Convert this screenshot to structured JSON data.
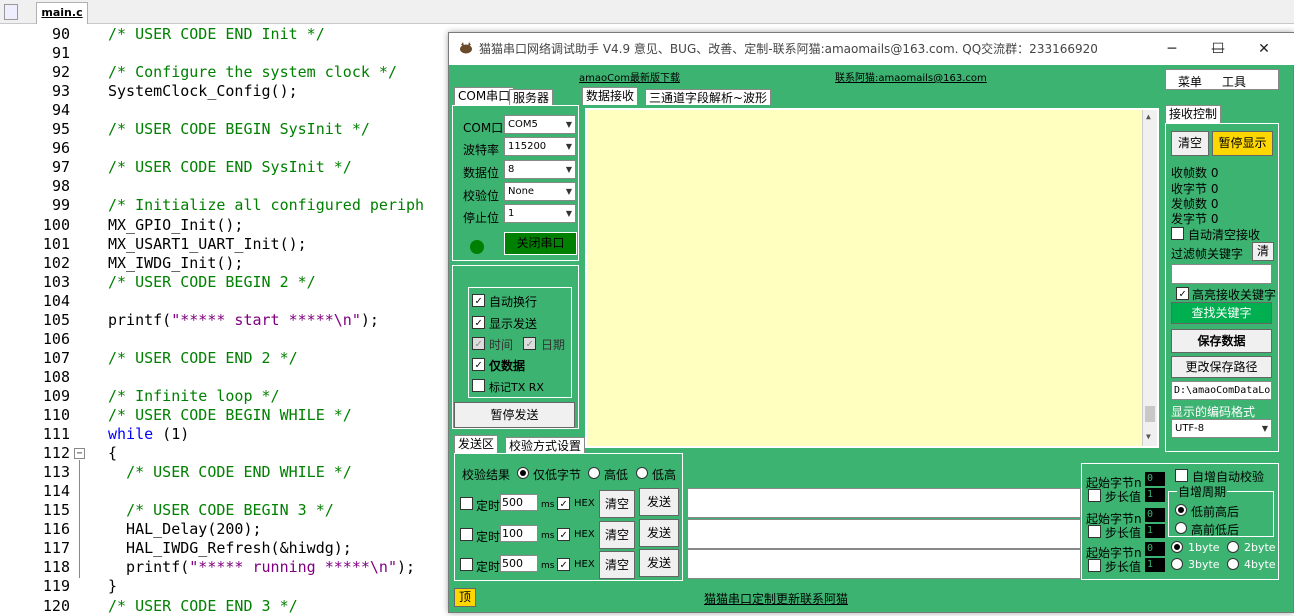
{
  "editor": {
    "tab_label": "main.c",
    "lines": [
      {
        "n": "90",
        "html": "<span class='cm'>/* USER CODE END Init */</span>"
      },
      {
        "n": "91",
        "html": ""
      },
      {
        "n": "92",
        "html": "<span class='cm'>/* Configure the system clock */</span>"
      },
      {
        "n": "93",
        "html": "SystemClock_Config();"
      },
      {
        "n": "94",
        "html": ""
      },
      {
        "n": "95",
        "html": "<span class='cm'>/* USER CODE BEGIN SysInit */</span>"
      },
      {
        "n": "96",
        "html": ""
      },
      {
        "n": "97",
        "html": "<span class='cm'>/* USER CODE END SysInit */</span>"
      },
      {
        "n": "98",
        "html": ""
      },
      {
        "n": "99",
        "html": "<span class='cm'>/* Initialize all configured periph</span>"
      },
      {
        "n": "100",
        "html": "MX_GPIO_Init();"
      },
      {
        "n": "101",
        "html": "MX_USART1_UART_Init();"
      },
      {
        "n": "102",
        "html": "MX_IWDG_Init();"
      },
      {
        "n": "103",
        "html": "<span class='cm'>/* USER CODE BEGIN 2 */</span>"
      },
      {
        "n": "104",
        "html": ""
      },
      {
        "n": "105",
        "html": "printf(<span class='str'>\"***** start *****\\n\"</span>);"
      },
      {
        "n": "106",
        "html": ""
      },
      {
        "n": "107",
        "html": "<span class='cm'>/* USER CODE END 2 */</span>"
      },
      {
        "n": "108",
        "html": ""
      },
      {
        "n": "109",
        "html": "<span class='cm'>/* Infinite loop */</span>"
      },
      {
        "n": "110",
        "html": "<span class='cm'>/* USER CODE BEGIN WHILE */</span>"
      },
      {
        "n": "111",
        "html": "<span class='kw'>while</span> (1)"
      },
      {
        "n": "112",
        "html": "{"
      },
      {
        "n": "113",
        "html": "  <span class='cm'>/* USER CODE END WHILE */</span>"
      },
      {
        "n": "114",
        "html": ""
      },
      {
        "n": "115",
        "html": "  <span class='cm'>/* USER CODE BEGIN 3 */</span>"
      },
      {
        "n": "116",
        "html": "  HAL_Delay(200);"
      },
      {
        "n": "117",
        "html": "  HAL_IWDG_Refresh(&amp;hiwdg);"
      },
      {
        "n": "118",
        "html": "  printf(<span class='str'>\"***** running *****\\n\"</span>);"
      },
      {
        "n": "119",
        "html": "}"
      },
      {
        "n": "120",
        "html": "<span class='cm'>/* USER CODE END 3 */</span>"
      }
    ]
  },
  "app": {
    "title": "猫猫串口网络调试助手 V4.9 意见、BUG、改善、定制-联系阿猫:amaomails@163.com. QQ交流群：233166920",
    "download_link": "amaoCom最新版下载",
    "contact_link": "联系阿猫:amaomails@163.com",
    "menu": "菜单",
    "tools": "工具",
    "tabs_left": [
      "COM串口",
      "服务器"
    ],
    "tabs_center": [
      "数据接收",
      "三通道字段解析~波形"
    ],
    "tab_right": "接收控制",
    "com": {
      "port_label": "COM口",
      "port_value": "COM5",
      "baud_label": "波特率",
      "baud_value": "115200",
      "databits_label": "数据位",
      "databits_value": "8",
      "parity_label": "校验位",
      "parity_value": "None",
      "stopbits_label": "停止位",
      "stopbits_value": "1",
      "close_button": "关闭串口"
    },
    "options": {
      "auto_wrap": "自动换行",
      "show_send": "显示发送",
      "time": "时间",
      "date": "日期",
      "data_only": "仅数据",
      "mark_txrx": "标记TX RX",
      "pause_send": "暂停发送"
    },
    "send_tabs": [
      "发送区",
      "校验方式设置"
    ],
    "checksum": {
      "label": "校验结果",
      "opt1": "仅低字节",
      "opt2": "高低",
      "opt3": "低高"
    },
    "send_rows": [
      {
        "timer_label": "定时",
        "ms": "500",
        "unit": "ms",
        "hex": "HEX",
        "clear": "清空",
        "send": "发送"
      },
      {
        "timer_label": "定时",
        "ms": "100",
        "unit": "ms",
        "hex": "HEX",
        "clear": "清空",
        "send": "发送"
      },
      {
        "timer_label": "定时",
        "ms": "500",
        "unit": "ms",
        "hex": "HEX",
        "clear": "清空",
        "send": "发送"
      }
    ],
    "recv_ctrl": {
      "clear": "清空",
      "pause_display": "暂停显示",
      "rx_frames_label": "收帧数",
      "rx_frames": "0",
      "rx_bytes_label": "收字节",
      "rx_bytes": "0",
      "tx_frames_label": "发帧数",
      "tx_frames": "0",
      "tx_bytes_label": "发字节",
      "tx_bytes": "0",
      "auto_clear": "自动清空接收",
      "filter_label": "过滤帧关键字",
      "filter_clear": "清",
      "highlight": "高亮接收关键字",
      "find_keyword": "查找关键字",
      "save_data": "保存数据",
      "change_path": "更改保存路径",
      "path": "D:\\amaoComDataLo",
      "encoding_label": "显示的编码格式",
      "encoding": "UTF-8"
    },
    "frame_ctrl": {
      "start_label": "起始字节n",
      "step_label": "步长值",
      "rows": [
        {
          "start": "0",
          "step": "1"
        },
        {
          "start": "0",
          "step": "1"
        },
        {
          "start": "0",
          "step": "1"
        }
      ],
      "auto_inc_check": "自增自动校验",
      "period_group": "自增周期",
      "low_first": "低前高后",
      "high_first": "高前低后",
      "b1": "1byte",
      "b2": "2byte",
      "b3": "3byte",
      "b4": "4byte"
    },
    "topmost": "顶",
    "footer_link": "猫猫串口定制更新联系阿猫"
  }
}
